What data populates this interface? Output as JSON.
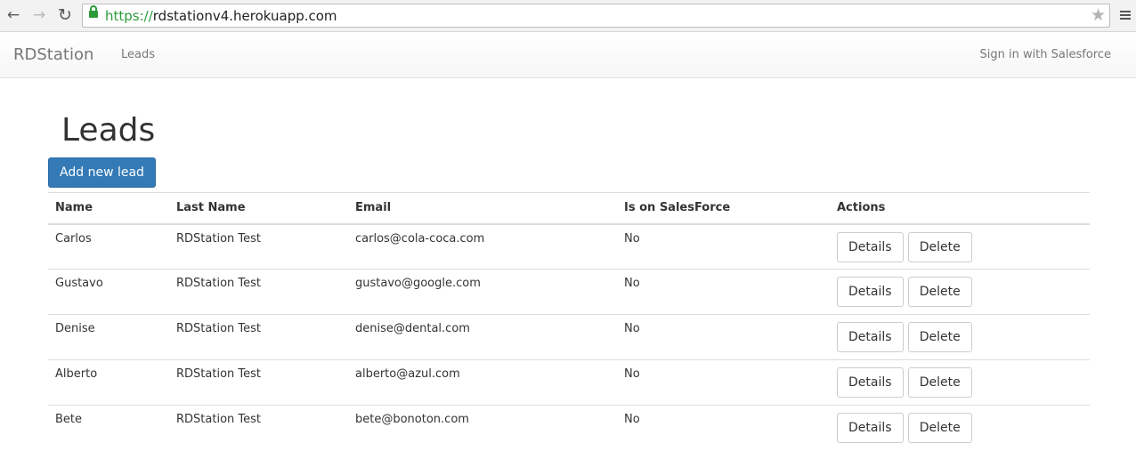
{
  "browser": {
    "url_scheme": "https://",
    "url_host": "rdstationv4.herokuapp.com"
  },
  "navbar": {
    "brand": "RDStation",
    "nav_item": "Leads",
    "signin": "Sign in with Salesforce"
  },
  "page": {
    "title": "Leads",
    "add_button": "Add new lead"
  },
  "table": {
    "headers": {
      "name": "Name",
      "last_name": "Last Name",
      "email": "Email",
      "salesforce": "Is on SalesForce",
      "actions": "Actions"
    },
    "rows": [
      {
        "name": "Carlos",
        "last_name": "RDStation Test",
        "email": "carlos@cola-coca.com",
        "salesforce": "No"
      },
      {
        "name": "Gustavo",
        "last_name": "RDStation Test",
        "email": "gustavo@google.com",
        "salesforce": "No"
      },
      {
        "name": "Denise",
        "last_name": "RDStation Test",
        "email": "denise@dental.com",
        "salesforce": "No"
      },
      {
        "name": "Alberto",
        "last_name": "RDStation Test",
        "email": "alberto@azul.com",
        "salesforce": "No"
      },
      {
        "name": "Bete",
        "last_name": "RDStation Test",
        "email": "bete@bonoton.com",
        "salesforce": "No"
      }
    ],
    "details_label": "Details",
    "delete_label": "Delete"
  },
  "icons": {
    "back": "arrow-left-icon",
    "forward": "arrow-right-icon",
    "reload": "reload-icon",
    "lock": "lock-icon",
    "bookmark": "star-icon",
    "menu": "hamburger-menu-icon"
  },
  "colors": {
    "primary": "#337ab7",
    "secure": "#2e9b3a"
  }
}
